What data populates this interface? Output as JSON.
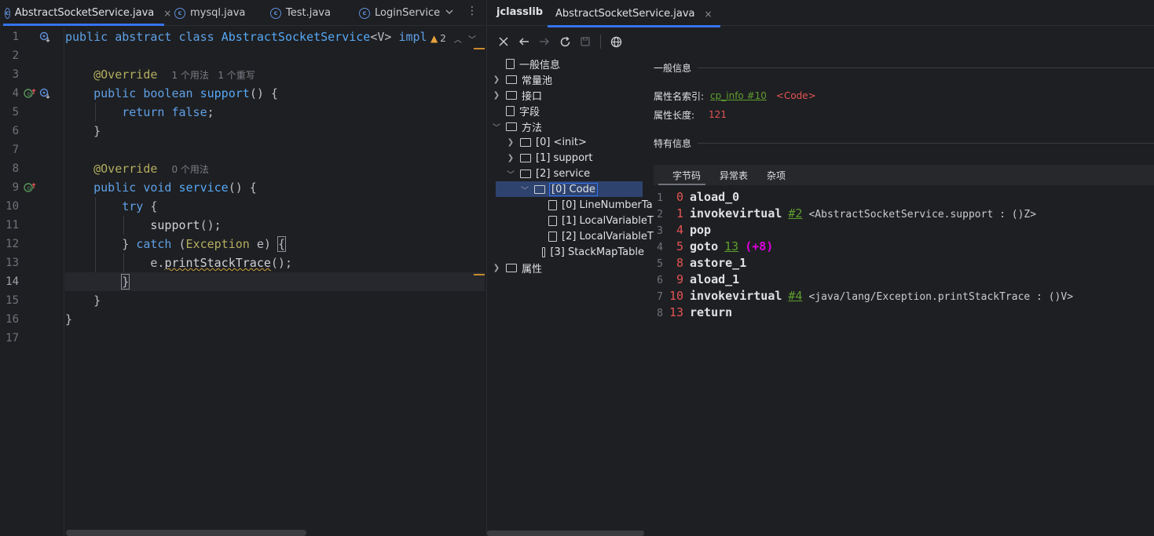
{
  "editor": {
    "tabs": [
      {
        "label": "AbstractSocketService.java",
        "active": true,
        "close": "×"
      },
      {
        "label": "mysql.java",
        "active": false
      },
      {
        "label": "Test.java",
        "active": false
      },
      {
        "label": "LoginService",
        "active": false
      }
    ],
    "tab_more_icon": "chevron-down-icon",
    "tab_menu_icon": "vertical-ellipsis-icon",
    "warning_count": "2",
    "line_numbers": [
      "1",
      "2",
      "3",
      "4",
      "5",
      "6",
      "7",
      "8",
      "9",
      "10",
      "11",
      "12",
      "13",
      "14",
      "15",
      "16",
      "17"
    ],
    "current_line": "14",
    "code": {
      "l1": {
        "kw1": "public",
        "kw2": "abstract",
        "kw3": "class",
        "name": "AbstractSocketService",
        "generic": "<V>",
        "impl": "impl"
      },
      "l3": {
        "ann": "@Override",
        "hint": "1 个用法   1 个重写"
      },
      "l4": {
        "kw1": "public",
        "kw2": "boolean",
        "fn": "support",
        "rest": "() {"
      },
      "l5": {
        "kw": "return",
        "val": "false",
        "rest": ";"
      },
      "l6": {
        "text": "}"
      },
      "l8": {
        "ann": "@Override",
        "hint": "0 个用法"
      },
      "l9": {
        "kw1": "public",
        "kw2": "void",
        "fn": "service",
        "rest": "() {"
      },
      "l10": {
        "kw": "try",
        "rest": " {"
      },
      "l11": {
        "call": "support",
        "rest": "();"
      },
      "l12": {
        "pre": "} ",
        "kw": "catch",
        "rest1": " (",
        "typ": "Exception",
        "rest2": " e) ",
        "brace": "{"
      },
      "l13": {
        "obj": "e.",
        "call": "printStackTrace",
        "rest": "();"
      },
      "l14": {
        "brace": "}"
      },
      "l15": {
        "text": "}"
      },
      "l16": {
        "text": "}"
      }
    }
  },
  "jclasslib": {
    "title": "jclasslib",
    "tab": {
      "label": "AbstractSocketService.java",
      "close": "×"
    },
    "toolbar": [
      "close-icon",
      "back-arrow-icon",
      "forward-arrow-icon",
      "refresh-icon",
      "save-icon",
      "globe-icon"
    ],
    "tree": [
      {
        "label": "一般信息",
        "type": "file",
        "level": 0
      },
      {
        "label": "常量池",
        "type": "folder",
        "level": 0,
        "expanded": false
      },
      {
        "label": "接口",
        "type": "folder",
        "level": 0,
        "expanded": false
      },
      {
        "label": "字段",
        "type": "file",
        "level": 0
      },
      {
        "label": "方法",
        "type": "folder",
        "level": 0,
        "expanded": true
      },
      {
        "label": "[0] <init>",
        "type": "folder",
        "level": 1,
        "expanded": false
      },
      {
        "label": "[1] support",
        "type": "folder",
        "level": 1,
        "expanded": false
      },
      {
        "label": "[2] service",
        "type": "folder",
        "level": 1,
        "expanded": true
      },
      {
        "label": "[0] Code",
        "type": "folder",
        "level": 2,
        "expanded": true,
        "selected": true
      },
      {
        "label": "[0] LineNumberTa",
        "type": "file",
        "level": 3
      },
      {
        "label": "[1] LocalVariableT",
        "type": "file",
        "level": 3
      },
      {
        "label": "[2] LocalVariableT",
        "type": "file",
        "level": 3
      },
      {
        "label": "[3] StackMapTable",
        "type": "file",
        "level": 3
      },
      {
        "label": "属性",
        "type": "folder",
        "level": 0,
        "expanded": false
      }
    ],
    "info": {
      "general_title": "一般信息",
      "attr_name_label": "属性名索引:",
      "attr_name_link": "cp_info #10",
      "attr_name_tag": "<Code>",
      "attr_len_label": "属性长度:",
      "attr_len_value": "121",
      "specific_title": "特有信息",
      "tabs": [
        "字节码",
        "异常表",
        "杂项"
      ],
      "active_tab": "字节码"
    },
    "bytecode": [
      {
        "line": "1",
        "offset": "0",
        "op": "aload_0"
      },
      {
        "line": "2",
        "offset": "1",
        "op": "invokevirtual",
        "ref": "#2",
        "comment": "<AbstractSocketService.support : ()Z>"
      },
      {
        "line": "3",
        "offset": "4",
        "op": "pop"
      },
      {
        "line": "4",
        "offset": "5",
        "op": "goto",
        "ref": "13",
        "rel": "(+8)"
      },
      {
        "line": "5",
        "offset": "8",
        "op": "astore_1"
      },
      {
        "line": "6",
        "offset": "9",
        "op": "aload_1"
      },
      {
        "line": "7",
        "offset": "10",
        "op": "invokevirtual",
        "ref": "#4",
        "comment": "<java/lang/Exception.printStackTrace : ()V>"
      },
      {
        "line": "8",
        "offset": "13",
        "op": "return"
      }
    ]
  },
  "colors": {
    "accent": "#3574f0",
    "keyword": "#cf8e6d",
    "function": "#56a8f5",
    "annotation": "#b3ae60",
    "link": "#5e9e2f",
    "offset": "#e45454",
    "relative": "#e000e0"
  }
}
